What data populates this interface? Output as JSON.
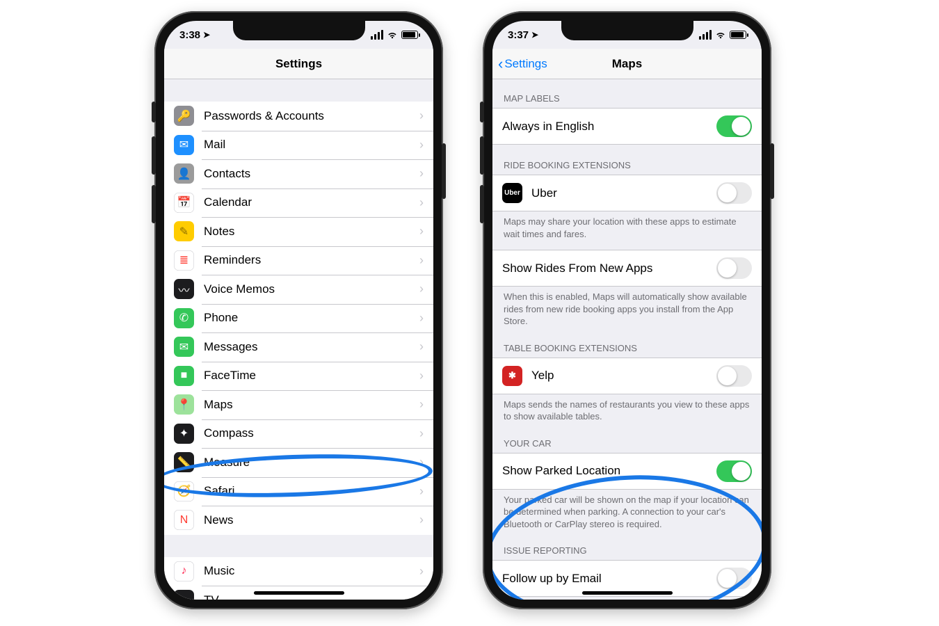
{
  "left": {
    "time": "3:38",
    "title": "Settings",
    "rows": [
      {
        "label": "Passwords & Accounts",
        "bg": "#8e8e93",
        "glyph": "🔑"
      },
      {
        "label": "Mail",
        "bg": "#1e90ff",
        "glyph": "✉"
      },
      {
        "label": "Contacts",
        "bg": "#9b9b9b",
        "glyph": "👤"
      },
      {
        "label": "Calendar",
        "bg": "#ffffff",
        "glyph": "📅",
        "fg": "#ff3b30"
      },
      {
        "label": "Notes",
        "bg": "#ffcc00",
        "glyph": "✎",
        "fg": "#8a6d00"
      },
      {
        "label": "Reminders",
        "bg": "#ffffff",
        "glyph": "≣",
        "fg": "#ff3b30"
      },
      {
        "label": "Voice Memos",
        "bg": "#1c1c1e",
        "glyph": "〰"
      },
      {
        "label": "Phone",
        "bg": "#34c759",
        "glyph": "✆"
      },
      {
        "label": "Messages",
        "bg": "#34c759",
        "glyph": "✉"
      },
      {
        "label": "FaceTime",
        "bg": "#34c759",
        "glyph": "■"
      },
      {
        "label": "Maps",
        "bg": "#9de29b",
        "glyph": "📍",
        "fg": "#0b5"
      },
      {
        "label": "Compass",
        "bg": "#1c1c1e",
        "glyph": "✦"
      },
      {
        "label": "Measure",
        "bg": "#1c1c1e",
        "glyph": "📏"
      },
      {
        "label": "Safari",
        "bg": "#ffffff",
        "glyph": "🧭",
        "fg": "#007aff"
      },
      {
        "label": "News",
        "bg": "#ffffff",
        "glyph": "N",
        "fg": "#ff3b30"
      }
    ],
    "rows2": [
      {
        "label": "Music",
        "bg": "#ffffff",
        "glyph": "♪",
        "fg": "#ff2d55"
      },
      {
        "label": "TV",
        "bg": "#1c1c1e",
        "glyph": "▶"
      }
    ]
  },
  "right": {
    "time": "3:37",
    "back": "Settings",
    "title": "Maps",
    "s1_header": "MAP LABELS",
    "always_english": "Always in English",
    "s2_header": "RIDE BOOKING EXTENSIONS",
    "uber": "Uber",
    "s2_note": "Maps may share your location with these apps to estimate wait times and fares.",
    "show_rides": "Show Rides From New Apps",
    "s2b_note": "When this is enabled, Maps will automatically show available rides from new ride booking apps you install from the App Store.",
    "s3_header": "TABLE BOOKING EXTENSIONS",
    "yelp": "Yelp",
    "s3_note": "Maps sends the names of restaurants you view to these apps to show available tables.",
    "s4_header": "YOUR CAR",
    "parked": "Show Parked Location",
    "s4_note": "Your parked car will be shown on the map if your location can be determined when parking. A connection to your car's Bluetooth or CarPlay stereo is required.",
    "s5_header": "ISSUE REPORTING",
    "followup": "Follow up by Email"
  }
}
